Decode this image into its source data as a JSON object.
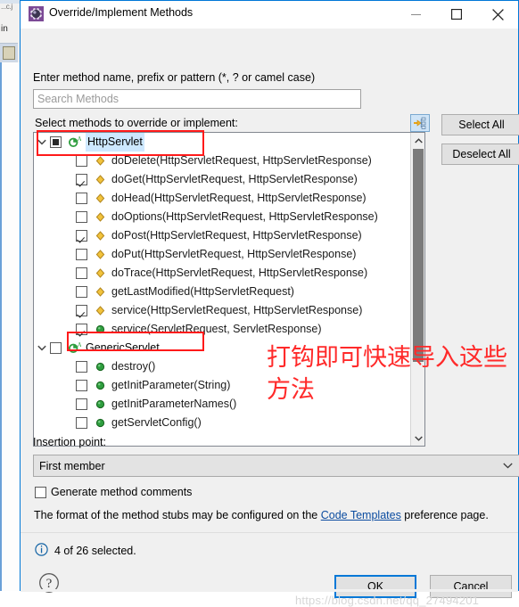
{
  "window": {
    "title": "Override/Implement Methods",
    "icon": "eclipse-gear-icon",
    "minimize_label": "Minimize",
    "maximize_label": "Maximize",
    "close_label": "Close"
  },
  "background": {
    "tab_text": "...c.j",
    "word": "in"
  },
  "search": {
    "prompt": "Enter method name, prefix or pattern (*, ? or camel case)",
    "placeholder": "Search Methods",
    "value": ""
  },
  "tree_header": {
    "label": "Select methods to override or implement:",
    "sync_icon": "link-with-editor-icon"
  },
  "buttons": {
    "select_all": "Select All",
    "deselect_all": "Deselect All",
    "ok": "OK",
    "cancel": "Cancel",
    "help_icon": "help-question-icon"
  },
  "tree": [
    {
      "label": "HttpServlet",
      "kind": "type",
      "checkbox": "partial",
      "icon": "class-abstract-icon",
      "selected": true,
      "expanded": true
    },
    {
      "label": "doDelete(HttpServletRequest, HttpServletResponse)",
      "kind": "method",
      "checkbox": "unchecked",
      "icon": "method-protected-icon"
    },
    {
      "label": "doGet(HttpServletRequest, HttpServletResponse)",
      "kind": "method",
      "checkbox": "checked",
      "icon": "method-protected-icon"
    },
    {
      "label": "doHead(HttpServletRequest, HttpServletResponse)",
      "kind": "method",
      "checkbox": "unchecked",
      "icon": "method-protected-icon"
    },
    {
      "label": "doOptions(HttpServletRequest, HttpServletResponse)",
      "kind": "method",
      "checkbox": "unchecked",
      "icon": "method-protected-icon"
    },
    {
      "label": "doPost(HttpServletRequest, HttpServletResponse)",
      "kind": "method",
      "checkbox": "checked",
      "icon": "method-protected-icon"
    },
    {
      "label": "doPut(HttpServletRequest, HttpServletResponse)",
      "kind": "method",
      "checkbox": "unchecked",
      "icon": "method-protected-icon"
    },
    {
      "label": "doTrace(HttpServletRequest, HttpServletResponse)",
      "kind": "method",
      "checkbox": "unchecked",
      "icon": "method-protected-icon"
    },
    {
      "label": "getLastModified(HttpServletRequest)",
      "kind": "method",
      "checkbox": "unchecked",
      "icon": "method-protected-icon"
    },
    {
      "label": "service(HttpServletRequest, HttpServletResponse)",
      "kind": "method",
      "checkbox": "checked",
      "icon": "method-protected-icon"
    },
    {
      "label": "service(ServletRequest, ServletResponse)",
      "kind": "method",
      "checkbox": "checked",
      "icon": "method-public-icon"
    },
    {
      "label": "GenericServlet",
      "kind": "type",
      "checkbox": "unchecked",
      "icon": "class-abstract-icon",
      "selected": false,
      "expanded": true
    },
    {
      "label": "destroy()",
      "kind": "method",
      "checkbox": "unchecked",
      "icon": "method-public-icon"
    },
    {
      "label": "getInitParameter(String)",
      "kind": "method",
      "checkbox": "unchecked",
      "icon": "method-public-icon"
    },
    {
      "label": "getInitParameterNames()",
      "kind": "method",
      "checkbox": "unchecked",
      "icon": "method-public-icon"
    },
    {
      "label": "getServletConfig()",
      "kind": "method",
      "checkbox": "unchecked",
      "icon": "method-public-icon"
    }
  ],
  "insertion": {
    "label": "Insertion point:",
    "value": "First member"
  },
  "generate_comments": {
    "label": "Generate method comments",
    "checked": false
  },
  "format_note": {
    "before": "The format of the method stubs may be configured on the ",
    "link": "Code Templates",
    "after": " preference page."
  },
  "status": {
    "icon": "info-icon",
    "text": "4 of 26 selected."
  },
  "annotations": {
    "chinese_note": "打钩即可快速导入这些\n方法",
    "note_color": "#ff2a2a",
    "box_color": "#ff1a1a"
  },
  "watermark": "https://blog.csdn.net/qq_27494201"
}
